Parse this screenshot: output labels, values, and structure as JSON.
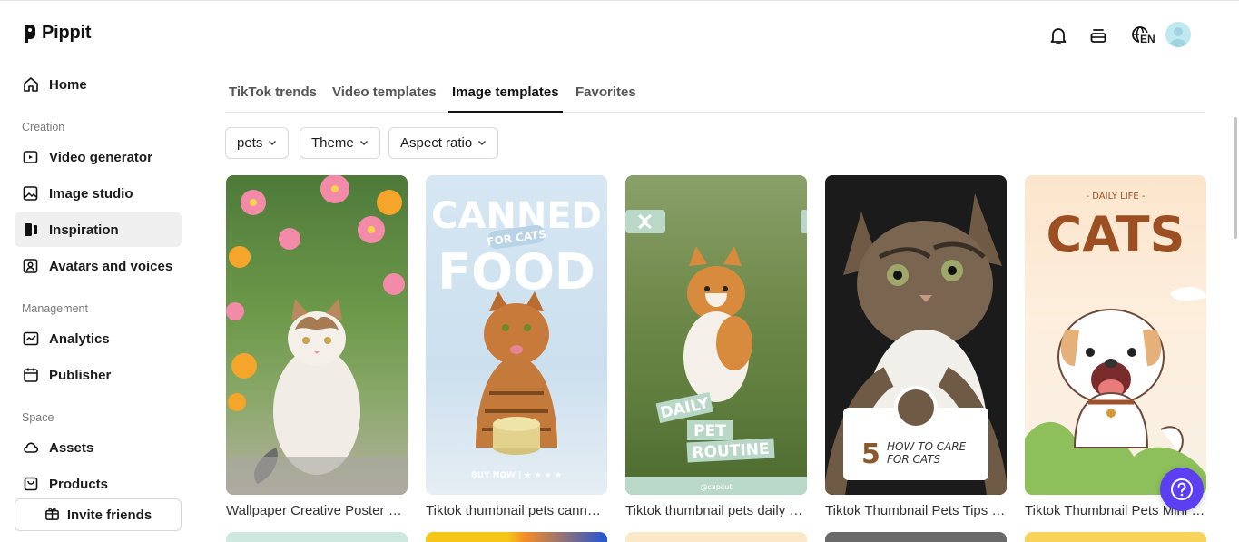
{
  "app": {
    "name": "Pippit"
  },
  "sidebar": {
    "home": "Home",
    "sections": {
      "creation": "Creation",
      "management": "Management",
      "space": "Space"
    },
    "creation_items": [
      "Video generator",
      "Image studio",
      "Inspiration",
      "Avatars and voices"
    ],
    "management_items": [
      "Analytics",
      "Publisher"
    ],
    "space_items": [
      "Assets",
      "Products"
    ],
    "invite": "Invite friends",
    "active_item": "Inspiration"
  },
  "header": {
    "language": "EN",
    "icons": [
      "bell-icon",
      "layers-icon",
      "globe-icon",
      "avatar"
    ]
  },
  "tabs": [
    "TikTok trends",
    "Video templates",
    "Image templates",
    "Favorites"
  ],
  "active_tab": "Image templates",
  "filters": [
    "pets",
    "Theme",
    "Aspect ratio"
  ],
  "cards": [
    {
      "title": "Wallpaper Creative Poster Cat",
      "bg": "#6f9a55"
    },
    {
      "title": "Tiktok thumbnail pets canned food",
      "bg": "#cfe2f0",
      "text": {
        "line1": "CANNED",
        "tag": "FOR CATS",
        "line2": "FOOD",
        "footer": "BUY NOW | ★ ★ ★ ★"
      }
    },
    {
      "title": "Tiktok thumbnail pets daily vlog",
      "bg": "#6f8b4a",
      "text": {
        "w1": "DAILY",
        "w2": "PET",
        "w3": "ROUTINE",
        "footer": "@capcut"
      }
    },
    {
      "title": "Tiktok Thumbnail Pets Tips Instagram",
      "bg": "#1c1c1c",
      "text": {
        "num": "5",
        "l1": "HOW TO CARE",
        "l2": "FOR CATS"
      }
    },
    {
      "title": "Tiktok Thumbnail Pets Mini Vlog",
      "bg": "#fbe9d6",
      "text": {
        "sub": "- DAILY LIFE -",
        "main": "CATS"
      }
    }
  ],
  "colors": {
    "accent": "#5b3ff0",
    "active_bg": "#efefef"
  }
}
